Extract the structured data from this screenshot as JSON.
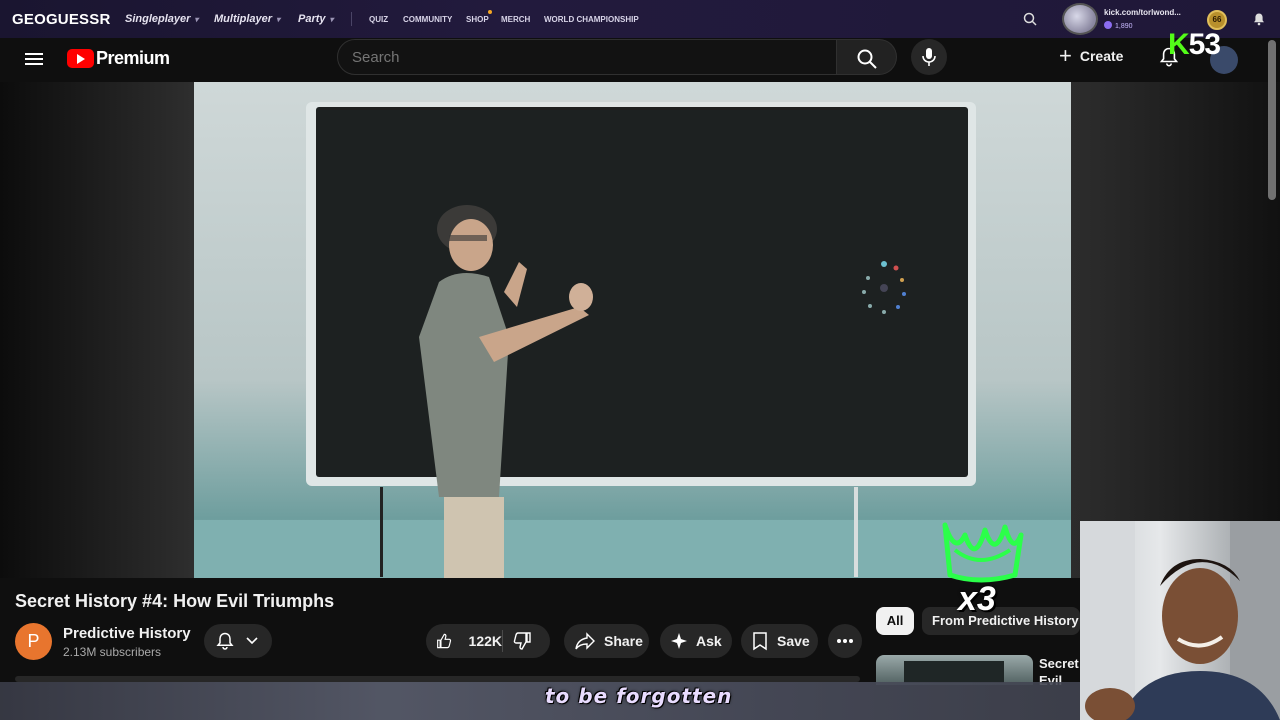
{
  "geoguessr": {
    "logo": "GEOGUESSR",
    "nav": [
      "Singleplayer",
      "Multiplayer",
      "Party"
    ],
    "links": [
      "QUIZ",
      "COMMUNITY",
      "SHOP",
      "MERCH",
      "WORLD CHAMPIONSHIP"
    ],
    "username": "kick.com/torlwond...",
    "coins": "1,890",
    "level": "66"
  },
  "youtube": {
    "logo_text": "Premium",
    "search_placeholder": "Search",
    "create_label": "Create",
    "kick_overlay": "53"
  },
  "video": {
    "title": "Secret History #4: How Evil Triumphs",
    "channel_initial": "P",
    "channel_name": "Predictive History",
    "subscribers": "2.13M subscribers",
    "likes": "122K",
    "share_label": "Share",
    "ask_label": "Ask",
    "save_label": "Save"
  },
  "sidebar": {
    "chips": [
      "All",
      "From Predictive History"
    ],
    "rec_title_line1": "Secret",
    "rec_title_line2": "Evil"
  },
  "overlay": {
    "caption": "to be forgotten",
    "emote_count": "x3"
  },
  "colors": {
    "youtube_red": "#ff0000",
    "kick_green": "#53fc18",
    "channel_avatar": "#e8752e"
  }
}
